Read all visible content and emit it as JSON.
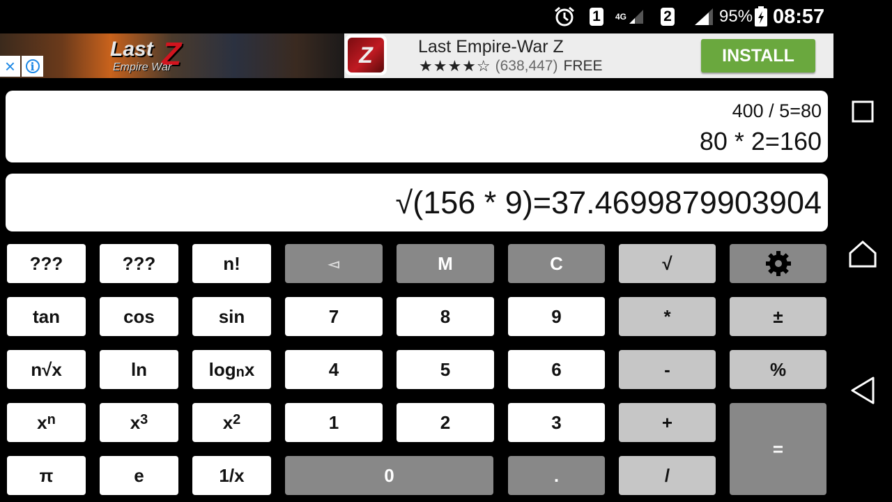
{
  "status_bar": {
    "sim1": "1",
    "network1": "4G",
    "sim2": "2",
    "battery_percent": "95%",
    "time": "08:57"
  },
  "ad": {
    "banner_text": "Last",
    "banner_z": "Z",
    "banner_sub": "Empire War",
    "close_icon": "×",
    "info_icon": "i",
    "app_icon_letter": "Z",
    "title": "Last Empire-War Z",
    "stars": "★★★★☆",
    "rating_count": "(638,447)",
    "price": "FREE",
    "install_label": "INSTALL"
  },
  "display": {
    "history_line1": "400 / 5=80",
    "history_line2": "80 * 2=160",
    "current": "√(156 * 9)=37.4699879903904"
  },
  "keys": {
    "unknown1": "???",
    "unknown2": "???",
    "factorial": "n!",
    "backspace": "◅",
    "memory": "M",
    "clear": "C",
    "sqrt": "√",
    "tan": "tan",
    "cos": "cos",
    "sin": "sin",
    "seven": "7",
    "eight": "8",
    "nine": "9",
    "multiply": "*",
    "plus_minus": "±",
    "nth_root": "n√x",
    "ln": "ln",
    "log_base": "log",
    "log_sub": "n",
    "log_x": "x",
    "four": "4",
    "five": "5",
    "six": "6",
    "minus": "-",
    "percent": "%",
    "pow_base": "x",
    "pow_n": "n",
    "cube_base": "x",
    "cube_exp": "3",
    "square_base": "x",
    "square_exp": "2",
    "one": "1",
    "two": "2",
    "three": "3",
    "plus": "+",
    "equals": "=",
    "pi": "π",
    "e": "e",
    "reciprocal": "1/x",
    "zero": "0",
    "decimal": ".",
    "divide": "/"
  },
  "colors": {
    "key_white": "#ffffff",
    "key_light": "#c6c6c6",
    "key_dark": "#888888",
    "install_green": "#6aa83e",
    "ad_info_blue": "#1e88e5"
  }
}
